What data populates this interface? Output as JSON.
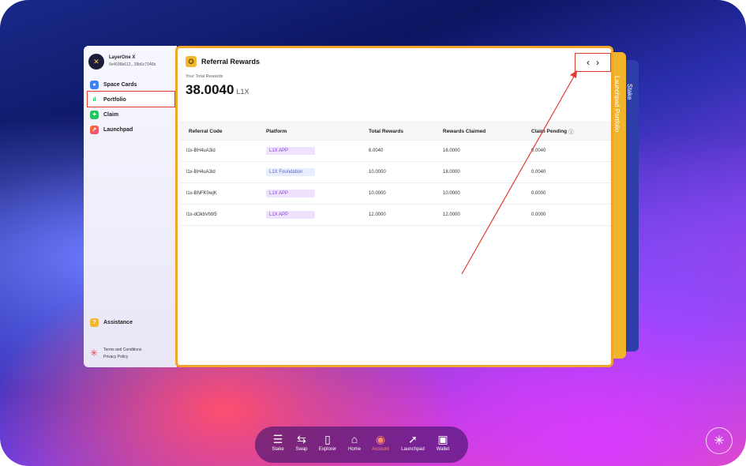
{
  "account": {
    "name": "LayerOne X",
    "address": "0x4036b612...39b6c7146b"
  },
  "sidebar": {
    "items": [
      {
        "label": "Space Cards",
        "icon": "user-icon",
        "color": "#3b82f6"
      },
      {
        "label": "Portfolio",
        "icon": "chart-icon",
        "color": "#ffffff"
      },
      {
        "label": "Claim",
        "icon": "gift-icon",
        "color": "#22c55e"
      },
      {
        "label": "Launchpad",
        "icon": "rocket-icon",
        "color": "#ec4899"
      }
    ],
    "assistance": "Assistance",
    "terms": "Terms and Conditions",
    "privacy": "Privacy Policy"
  },
  "stack_tabs": {
    "launchpad_portfolio": "Launchpad Portfolio",
    "stake": "Stake"
  },
  "main": {
    "title": "Referral Rewards",
    "total_label": "Your Total Rewards",
    "total_value": "38.0040",
    "total_unit": "L1X",
    "prev": "‹",
    "next": "›",
    "columns": [
      "Referral Code",
      "Platform",
      "Total Rewards",
      "Rewards Claimed",
      "Claim Pending"
    ],
    "rows": [
      {
        "code": "l1x-BH4uA3id",
        "platform": "L1X APP",
        "total": "6.0040",
        "claimed": "16.0000",
        "pending": "0.0040",
        "style": "purple"
      },
      {
        "code": "l1x-BH4uA3id",
        "platform": "L1X Foundation",
        "total": "10.0000",
        "claimed": "18.0000",
        "pending": "0.0040",
        "style": "blue"
      },
      {
        "code": "l1x-BNFK0wjK",
        "platform": "L1X APP",
        "total": "10.0000",
        "claimed": "10.0000",
        "pending": "0.0000",
        "style": "purple"
      },
      {
        "code": "l1x-dOkbVtW5",
        "platform": "L1X APP",
        "total": "12.0000",
        "claimed": "12.0000",
        "pending": "0.0000",
        "style": "purple"
      }
    ]
  },
  "dock": [
    {
      "label": "Stake",
      "icon": "layers-icon"
    },
    {
      "label": "Swap",
      "icon": "swap-icon"
    },
    {
      "label": "Explorer",
      "icon": "explorer-icon"
    },
    {
      "label": "Home",
      "icon": "home-icon"
    },
    {
      "label": "Account",
      "icon": "account-icon"
    },
    {
      "label": "Launchpad",
      "icon": "rocket-icon"
    },
    {
      "label": "Wallet",
      "icon": "wallet-icon"
    }
  ],
  "colors": {
    "accent_orange": "#f1a52b",
    "highlight_red": "#e53b2f",
    "stake_blue": "#2e3ea8"
  }
}
